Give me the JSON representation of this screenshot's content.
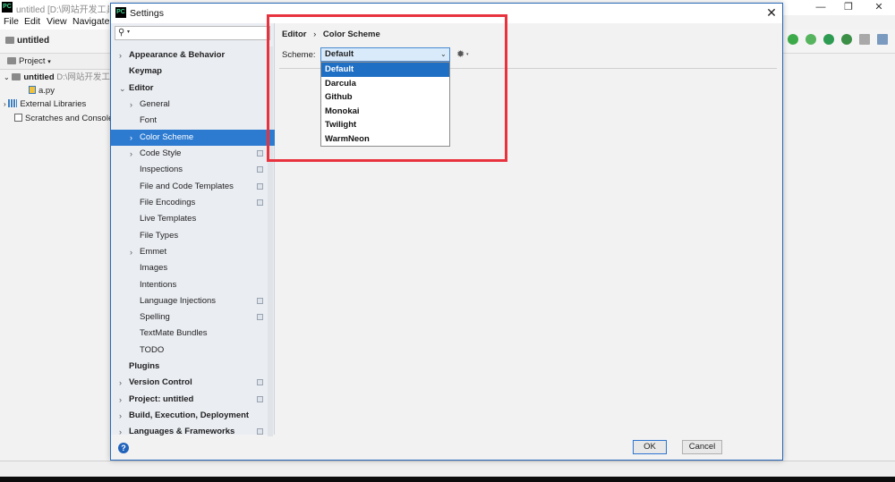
{
  "ide": {
    "logo": "PC",
    "title": "untitled [D:\\网站开发工具\\",
    "menu": {
      "file": "File",
      "edit": "Edit",
      "view": "View",
      "navigate": "Navigate"
    },
    "nav_project": "untitled",
    "project_tab": "Project",
    "tree": {
      "root": "untitled",
      "root_path": "D:\\网站开发工",
      "file": "a.py",
      "libs": "External Libraries",
      "scratches": "Scratches and Consoles"
    },
    "window_controls": {
      "minimize": "—",
      "restore": "❐",
      "close": "✕"
    }
  },
  "dialog": {
    "logo": "PC",
    "title": "Settings",
    "close": "✕",
    "breadcrumb": {
      "parent": "Editor",
      "separator": "›",
      "current": "Color Scheme"
    },
    "scheme_label": "Scheme:",
    "scheme_value": "Default",
    "scheme_options": [
      "Default",
      "Darcula",
      "Github",
      "Monokai",
      "Twilight",
      "WarmNeon"
    ],
    "help": "?",
    "ok": "OK",
    "cancel": "Cancel"
  },
  "sidebar": {
    "items": [
      {
        "label": "Appearance & Behavior",
        "arrow": "›"
      },
      {
        "label": "Keymap"
      },
      {
        "label": "Editor",
        "arrow": "⌄"
      },
      {
        "label": "General",
        "arrow": "›"
      },
      {
        "label": "Font"
      },
      {
        "label": "Color Scheme",
        "arrow": "›"
      },
      {
        "label": "Code Style",
        "arrow": "›"
      },
      {
        "label": "Inspections"
      },
      {
        "label": "File and Code Templates"
      },
      {
        "label": "File Encodings"
      },
      {
        "label": "Live Templates"
      },
      {
        "label": "File Types"
      },
      {
        "label": "Emmet",
        "arrow": "›"
      },
      {
        "label": "Images"
      },
      {
        "label": "Intentions"
      },
      {
        "label": "Language Injections"
      },
      {
        "label": "Spelling"
      },
      {
        "label": "TextMate Bundles"
      },
      {
        "label": "TODO"
      },
      {
        "label": "Plugins"
      },
      {
        "label": "Version Control",
        "arrow": "›"
      },
      {
        "label": "Project: untitled",
        "arrow": "›"
      },
      {
        "label": "Build, Execution, Deployment",
        "arrow": "›"
      },
      {
        "label": "Languages & Frameworks",
        "arrow": "›"
      }
    ]
  },
  "colors": {
    "accent": "#2d7bd1",
    "highlight": "#e8333f"
  }
}
